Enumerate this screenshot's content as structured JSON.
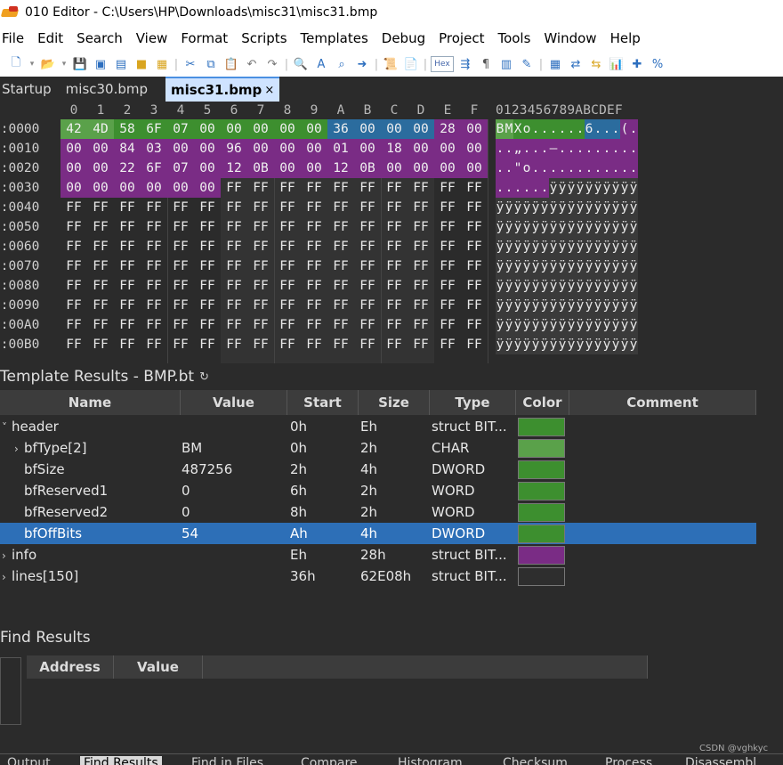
{
  "window": {
    "title": "010 Editor - C:\\Users\\HP\\Downloads\\misc31\\misc31.bmp"
  },
  "menu": [
    "File",
    "Edit",
    "Search",
    "View",
    "Format",
    "Scripts",
    "Templates",
    "Debug",
    "Project",
    "Tools",
    "Window",
    "Help"
  ],
  "toolbar": {
    "hex_label": "Hex"
  },
  "tabs": [
    {
      "label": "Startup"
    },
    {
      "label": "misc30.bmp"
    },
    {
      "label": "misc31.bmp",
      "close": "×"
    }
  ],
  "hex": {
    "column_headers": [
      "0",
      "1",
      "2",
      "3",
      "4",
      "5",
      "6",
      "7",
      "8",
      "9",
      "A",
      "B",
      "C",
      "D",
      "E",
      "F"
    ],
    "ascii_header": "0123456789ABCDEF",
    "rows": [
      {
        "addr": "0:0000",
        "bytes": [
          "42",
          "4D",
          "58",
          "6F",
          "07",
          "00",
          "00",
          "00",
          "00",
          "00",
          "36",
          "00",
          "00",
          "00",
          "28",
          "00"
        ],
        "ascii": "BMXo......6...(."
      },
      {
        "addr": "0:0010",
        "bytes": [
          "00",
          "00",
          "84",
          "03",
          "00",
          "00",
          "96",
          "00",
          "00",
          "00",
          "01",
          "00",
          "18",
          "00",
          "00",
          "00"
        ],
        "ascii": "..„...–........."
      },
      {
        "addr": "0:0020",
        "bytes": [
          "00",
          "00",
          "22",
          "6F",
          "07",
          "00",
          "12",
          "0B",
          "00",
          "00",
          "12",
          "0B",
          "00",
          "00",
          "00",
          "00"
        ],
        "ascii": "..\"o............"
      },
      {
        "addr": "0:0030",
        "bytes": [
          "00",
          "00",
          "00",
          "00",
          "00",
          "00",
          "FF",
          "FF",
          "FF",
          "FF",
          "FF",
          "FF",
          "FF",
          "FF",
          "FF",
          "FF"
        ],
        "ascii": "......ÿÿÿÿÿÿÿÿÿÿ"
      },
      {
        "addr": "0:0040",
        "bytes": [
          "FF",
          "FF",
          "FF",
          "FF",
          "FF",
          "FF",
          "FF",
          "FF",
          "FF",
          "FF",
          "FF",
          "FF",
          "FF",
          "FF",
          "FF",
          "FF"
        ],
        "ascii": "ÿÿÿÿÿÿÿÿÿÿÿÿÿÿÿÿ"
      },
      {
        "addr": "0:0050",
        "bytes": [
          "FF",
          "FF",
          "FF",
          "FF",
          "FF",
          "FF",
          "FF",
          "FF",
          "FF",
          "FF",
          "FF",
          "FF",
          "FF",
          "FF",
          "FF",
          "FF"
        ],
        "ascii": "ÿÿÿÿÿÿÿÿÿÿÿÿÿÿÿÿ"
      },
      {
        "addr": "0:0060",
        "bytes": [
          "FF",
          "FF",
          "FF",
          "FF",
          "FF",
          "FF",
          "FF",
          "FF",
          "FF",
          "FF",
          "FF",
          "FF",
          "FF",
          "FF",
          "FF",
          "FF"
        ],
        "ascii": "ÿÿÿÿÿÿÿÿÿÿÿÿÿÿÿÿ"
      },
      {
        "addr": "0:0070",
        "bytes": [
          "FF",
          "FF",
          "FF",
          "FF",
          "FF",
          "FF",
          "FF",
          "FF",
          "FF",
          "FF",
          "FF",
          "FF",
          "FF",
          "FF",
          "FF",
          "FF"
        ],
        "ascii": "ÿÿÿÿÿÿÿÿÿÿÿÿÿÿÿÿ"
      },
      {
        "addr": "0:0080",
        "bytes": [
          "FF",
          "FF",
          "FF",
          "FF",
          "FF",
          "FF",
          "FF",
          "FF",
          "FF",
          "FF",
          "FF",
          "FF",
          "FF",
          "FF",
          "FF",
          "FF"
        ],
        "ascii": "ÿÿÿÿÿÿÿÿÿÿÿÿÿÿÿÿ"
      },
      {
        "addr": "0:0090",
        "bytes": [
          "FF",
          "FF",
          "FF",
          "FF",
          "FF",
          "FF",
          "FF",
          "FF",
          "FF",
          "FF",
          "FF",
          "FF",
          "FF",
          "FF",
          "FF",
          "FF"
        ],
        "ascii": "ÿÿÿÿÿÿÿÿÿÿÿÿÿÿÿÿ"
      },
      {
        "addr": "0:00A0",
        "bytes": [
          "FF",
          "FF",
          "FF",
          "FF",
          "FF",
          "FF",
          "FF",
          "FF",
          "FF",
          "FF",
          "FF",
          "FF",
          "FF",
          "FF",
          "FF",
          "FF"
        ],
        "ascii": "ÿÿÿÿÿÿÿÿÿÿÿÿÿÿÿÿ"
      },
      {
        "addr": "0:00B0",
        "bytes": [
          "FF",
          "FF",
          "FF",
          "FF",
          "FF",
          "FF",
          "FF",
          "FF",
          "FF",
          "FF",
          "FF",
          "FF",
          "FF",
          "FF",
          "FF",
          "FF"
        ],
        "ascii": "ÿÿÿÿÿÿÿÿÿÿÿÿÿÿÿÿ"
      }
    ]
  },
  "template": {
    "title": "Template Results - BMP.bt",
    "columns": [
      "Name",
      "Value",
      "Start",
      "Size",
      "Type",
      "Color",
      "Comment"
    ],
    "rows": [
      {
        "name": "header",
        "value": "",
        "start": "0h",
        "size": "Eh",
        "type": "struct BIT...",
        "color": "#3d8f2f",
        "expand": "expanded"
      },
      {
        "name": "bfType[2]",
        "value": "BM",
        "start": "0h",
        "size": "2h",
        "type": "CHAR",
        "color": "#5aa14a",
        "expand": "collapsed"
      },
      {
        "name": "bfSize",
        "value": "487256",
        "start": "2h",
        "size": "4h",
        "type": "DWORD",
        "color": "#3d8f2f",
        "expand": "none"
      },
      {
        "name": "bfReserved1",
        "value": "0",
        "start": "6h",
        "size": "2h",
        "type": "WORD",
        "color": "#3d8f2f",
        "expand": "none"
      },
      {
        "name": "bfReserved2",
        "value": "0",
        "start": "8h",
        "size": "2h",
        "type": "WORD",
        "color": "#3d8f2f",
        "expand": "none"
      },
      {
        "name": "bfOffBits",
        "value": "54",
        "start": "Ah",
        "size": "4h",
        "type": "DWORD",
        "color": "#3d8f2f",
        "expand": "none",
        "selected": true
      },
      {
        "name": "info",
        "value": "",
        "start": "Eh",
        "size": "28h",
        "type": "struct BIT...",
        "color": "#7a2c85",
        "expand": "collapsed"
      },
      {
        "name": "lines[150]",
        "value": "",
        "start": "36h",
        "size": "62E08h",
        "type": "struct BIT...",
        "color": "#2e2e2e",
        "expand": "collapsed"
      }
    ]
  },
  "find": {
    "title": "Find Results",
    "columns": [
      "Address",
      "Value"
    ]
  },
  "bottom_tabs": [
    "Output",
    "Find Results",
    "Find in Files",
    "Compare",
    "Histogram",
    "Checksum",
    "Process",
    "Disassembl"
  ],
  "watermark": "CSDN @vghkyc",
  "colors": {
    "green": "#3d8f2f",
    "light_green": "#5aa14a",
    "blue": "#2b6c9e",
    "purple": "#7a2c85",
    "selection": "#2d6fb7"
  }
}
